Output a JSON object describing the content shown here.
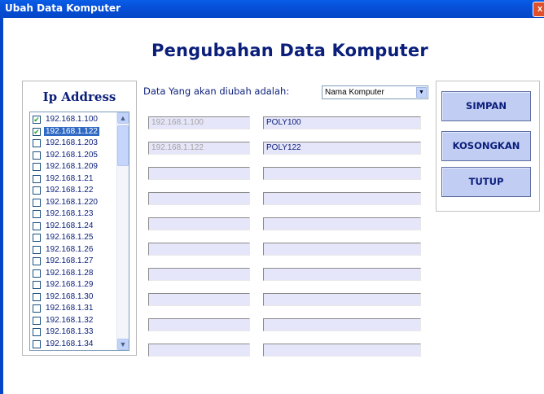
{
  "window": {
    "title": "Ubah Data Komputer",
    "close_label": "x"
  },
  "heading": "Pengubahan Data Komputer",
  "ip_panel": {
    "title": "Ip Address",
    "items": [
      {
        "label": "192.168.1.100",
        "checked": true,
        "selected": false
      },
      {
        "label": "192.168.1.122",
        "checked": true,
        "selected": true
      },
      {
        "label": "192.168.1.203",
        "checked": false,
        "selected": false
      },
      {
        "label": "192.168.1.205",
        "checked": false,
        "selected": false
      },
      {
        "label": "192.168.1.209",
        "checked": false,
        "selected": false
      },
      {
        "label": "192.168.1.21",
        "checked": false,
        "selected": false
      },
      {
        "label": "192.168.1.22",
        "checked": false,
        "selected": false
      },
      {
        "label": "192.168.1.220",
        "checked": false,
        "selected": false
      },
      {
        "label": "192.168.1.23",
        "checked": false,
        "selected": false
      },
      {
        "label": "192.168.1.24",
        "checked": false,
        "selected": false
      },
      {
        "label": "192.168.1.25",
        "checked": false,
        "selected": false
      },
      {
        "label": "192.168.1.26",
        "checked": false,
        "selected": false
      },
      {
        "label": "192.168.1.27",
        "checked": false,
        "selected": false
      },
      {
        "label": "192.168.1.28",
        "checked": false,
        "selected": false
      },
      {
        "label": "192.168.1.29",
        "checked": false,
        "selected": false
      },
      {
        "label": "192.168.1.30",
        "checked": false,
        "selected": false
      },
      {
        "label": "192.168.1.31",
        "checked": false,
        "selected": false
      },
      {
        "label": "192.168.1.32",
        "checked": false,
        "selected": false
      },
      {
        "label": "192.168.1.33",
        "checked": false,
        "selected": false
      },
      {
        "label": "192.168.1.34",
        "checked": false,
        "selected": false
      }
    ]
  },
  "form": {
    "prompt": "Data Yang akan diubah adalah:",
    "field_select": {
      "value": "Nama Komputer"
    },
    "rows": [
      {
        "ip": "192.168.1.100",
        "value": "POLY100"
      },
      {
        "ip": "192.168.1.122",
        "value": "POLY122"
      },
      {
        "ip": "",
        "value": ""
      },
      {
        "ip": "",
        "value": ""
      },
      {
        "ip": "",
        "value": ""
      },
      {
        "ip": "",
        "value": ""
      },
      {
        "ip": "",
        "value": ""
      },
      {
        "ip": "",
        "value": ""
      },
      {
        "ip": "",
        "value": ""
      },
      {
        "ip": "",
        "value": ""
      }
    ]
  },
  "buttons": {
    "save": "SIMPAN",
    "clear": "KOSONGKAN",
    "close": "TUTUP"
  },
  "colors": {
    "accent": "#0a1e7a",
    "titlebar": "#0650d8",
    "selection": "#316ac5",
    "field_bg": "#e6e6fa"
  }
}
